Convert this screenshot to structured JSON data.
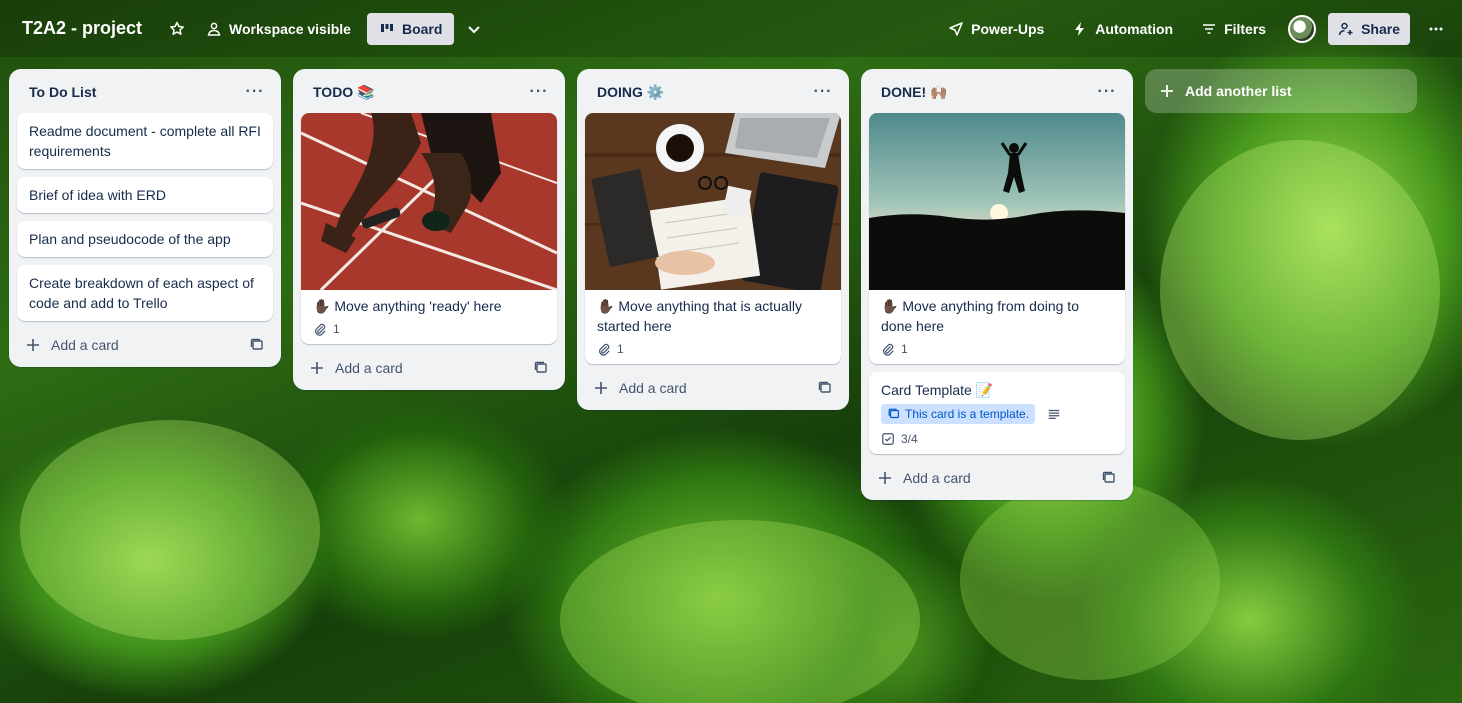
{
  "header": {
    "board_title": "T2A2 - project",
    "visibility": "Workspace visible",
    "view": "Board",
    "powerups": "Power-Ups",
    "automation": "Automation",
    "filters": "Filters",
    "share": "Share"
  },
  "lists": [
    {
      "title": "To Do List",
      "cards": [
        "Readme document - complete all RFI requirements",
        "Brief of idea with ERD",
        "Plan and pseudocode of the app",
        "Create breakdown of each aspect of code and add to Trello"
      ],
      "add_label": "Add a card"
    },
    {
      "title": "TODO 📚",
      "cover_card": {
        "text": "✋🏿 Move anything 'ready' here",
        "attachments": "1"
      },
      "add_label": "Add a card"
    },
    {
      "title": "DOING ⚙️",
      "cover_card": {
        "text": "✋🏿 Move anything that is actually started here",
        "attachments": "1"
      },
      "add_label": "Add a card"
    },
    {
      "title": "DONE! 🙌🏽",
      "cover_card": {
        "text": "✋🏿 Move anything from doing to done here",
        "attachments": "1"
      },
      "template_card": {
        "title": "Card Template 📝",
        "template_badge": "This card is a template.",
        "checklist": "3/4"
      },
      "add_label": "Add a card"
    }
  ],
  "add_another_list": "Add another list"
}
